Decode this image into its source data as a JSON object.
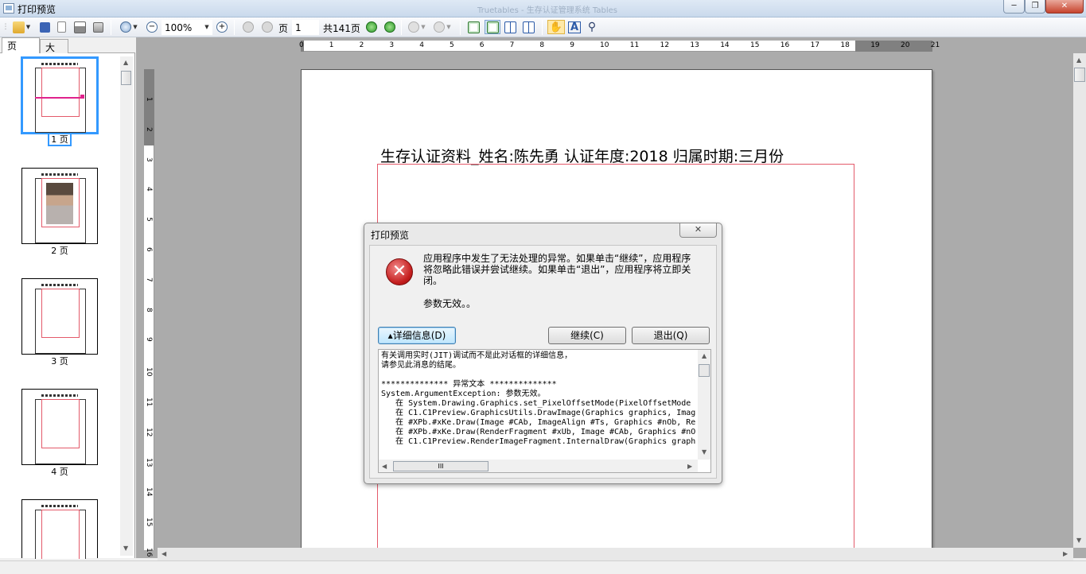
{
  "window": {
    "title": "打印预览",
    "ghost_title": "Truetables - 生存认证管理系统 Tables",
    "min_glyph": "─",
    "max_glyph": "❐",
    "close_glyph": "✕"
  },
  "toolbar": {
    "zoom_value": "100%",
    "page_label": "页",
    "page_value": "1",
    "page_total": "共141页",
    "hand_glyph": "✋",
    "text_glyph": "A",
    "find_glyph": "⚲"
  },
  "tabs": {
    "pages": "页",
    "outline": "大纲"
  },
  "thumbnails": [
    {
      "label": "1 页"
    },
    {
      "label": "2 页"
    },
    {
      "label": "3 页"
    },
    {
      "label": "4 页"
    }
  ],
  "ruler": {
    "h_ticks": [
      "0",
      "1",
      "2",
      "3",
      "4",
      "5",
      "6",
      "7",
      "8",
      "9",
      "10",
      "11",
      "12",
      "13",
      "14",
      "15",
      "16",
      "17",
      "18",
      "19",
      "20",
      "21"
    ],
    "v_ticks": [
      "1",
      "2",
      "3",
      "4",
      "5",
      "6",
      "7",
      "8",
      "9",
      "10",
      "11",
      "12",
      "13",
      "14",
      "15",
      "16"
    ]
  },
  "document": {
    "heading": "生存认证资料_姓名:陈先勇    认证年度:2018    归属时期:三月份"
  },
  "dialog": {
    "title": "打印预览",
    "close_glyph": "✕",
    "icon_glyph": "✕",
    "message": "应用程序中发生了无法处理的异常。如果单击“继续”，应用程序将忽略此错误并尝试继续。如果单击“退出”，应用程序将立即关闭。",
    "message2": "参数无效。。",
    "details_button": "▴详细信息(D)",
    "continue_button": "继续(C)",
    "quit_button": "退出(Q)",
    "details_text": "有关调用实时(JIT)调试而不是此对话框的详细信息，\n请参见此消息的结尾。\n\n************** 异常文本 **************\nSystem.ArgumentException: 参数无效。\n   在 System.Drawing.Graphics.set_PixelOffsetMode(PixelOffsetMode\n   在 C1.C1Preview.GraphicsUtils.DrawImage(Graphics graphics, Imag\n   在 #XPb.#xKe.Draw(Image #CAb, ImageAlign #Ts, Graphics #nOb, Re\n   在 #XPb.#xKe.Draw(RenderFragment #xUb, Image #CAb, Graphics #nO\n   在 C1.C1Preview.RenderImageFragment.InternalDraw(Graphics graph",
    "hscroll_grip": "III"
  },
  "colors": {
    "accent": "#3399ff",
    "error": "#c41e1e",
    "page_border": "#e35a6a"
  }
}
